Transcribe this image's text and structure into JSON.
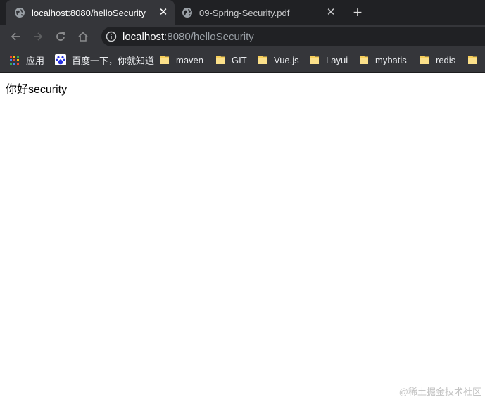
{
  "tabs": [
    {
      "title": "localhost:8080/helloSecurity",
      "active": true,
      "icon": "globe-icon"
    },
    {
      "title": "09-Spring-Security.pdf",
      "active": false,
      "icon": "globe-icon"
    }
  ],
  "new_tab_icon": "plus-icon",
  "toolbar": {
    "back_icon": "arrow-left-icon",
    "forward_icon": "arrow-right-icon",
    "reload_icon": "reload-icon",
    "home_icon": "home-icon",
    "info_icon": "info-icon",
    "url_host": "localhost",
    "url_rest": ":8080/helloSecurity"
  },
  "bookmarks": [
    {
      "label": "应用",
      "icon": "apps-grid-icon"
    },
    {
      "label": "百度一下，你就知道",
      "icon": "baidu-paw-icon"
    },
    {
      "label": "maven",
      "icon": "folder-icon"
    },
    {
      "label": "GIT",
      "icon": "folder-icon"
    },
    {
      "label": "Vue.js",
      "icon": "folder-icon"
    },
    {
      "label": "Layui",
      "icon": "folder-icon"
    },
    {
      "label": "mybatis",
      "icon": "folder-icon"
    },
    {
      "label": "redis",
      "icon": "folder-icon"
    }
  ],
  "page": {
    "content": "你好security"
  },
  "watermark": "@稀土掘金技术社区",
  "colors": {
    "tabstrip_bg": "#202124",
    "toolbar_bg": "#35363a",
    "omnibox_bg": "#202124",
    "folder_yellow": "#f7cf5a"
  }
}
